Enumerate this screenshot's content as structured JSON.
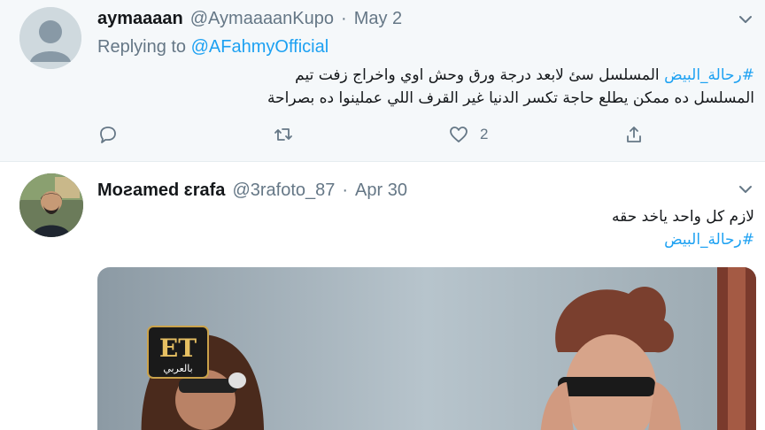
{
  "tweets": [
    {
      "author_name": "aymaaaan",
      "author_handle": "@AymaaaanKupo",
      "separator": "·",
      "date": "May 2",
      "replying_prefix": "Replying to",
      "replying_to": "@AFahmyOfficial",
      "hashtag": "#رحالة_البيض",
      "text_line1": " المسلسل سئ لابعد درجة ورق وحش اوي واخراج زفت تيم",
      "text_line2": "المسلسل ده ممكن يطلع حاجة تكسر الدنيا غير القرف اللي عملينوا ده بصراحة",
      "likes": "2",
      "avatar_icon": "default-avatar-icon"
    },
    {
      "author_name": "Moƨamed ɛrafa",
      "author_handle": "@3rafoto_87",
      "separator": "·",
      "date": "Apr 30",
      "text_line1": "لازم كل واحد ياخد حقه",
      "hashtag": "#رحالة_البيض",
      "media_logo_top": "ET",
      "media_logo_bottom": "بالعربي"
    }
  ],
  "icons": {
    "reply": "reply-icon",
    "retweet": "retweet-icon",
    "like": "heart-icon",
    "share": "share-icon",
    "menu": "chevron-down-icon"
  },
  "colors": {
    "accent": "#1da1f2",
    "secondary_text": "#657786",
    "reply_background": "#f5f8fa"
  }
}
